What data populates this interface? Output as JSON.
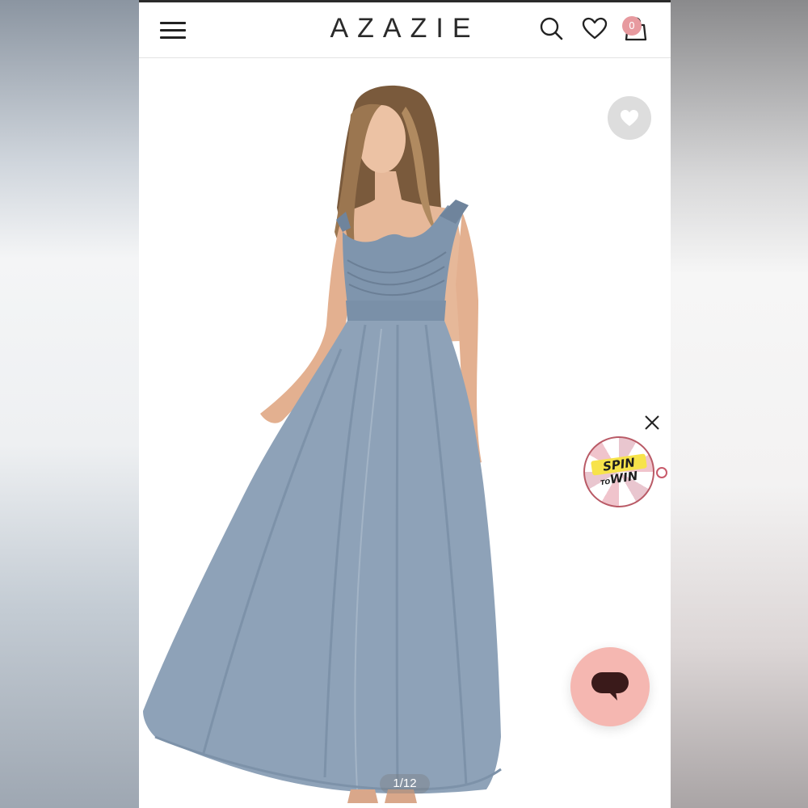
{
  "header": {
    "brand": "AZAZIE",
    "cart_count": "0",
    "icons": [
      "menu-icon",
      "search-icon",
      "heart-icon",
      "shopping-bag-icon"
    ]
  },
  "gallery": {
    "pager": "1/12",
    "favorite_icon": "heart-icon",
    "dress_color": "#8ea2b8",
    "image_description_icon": "product-photo"
  },
  "promo": {
    "line1": "SPIN",
    "line2_small": "TO",
    "line2": "WIN",
    "close_icon": "close-icon"
  },
  "chat": {
    "icon": "chat-bubble-icon",
    "color": "#f5b7b1"
  },
  "colors": {
    "accent_pink": "#e79a9f",
    "header_bg": "#ffffff"
  }
}
